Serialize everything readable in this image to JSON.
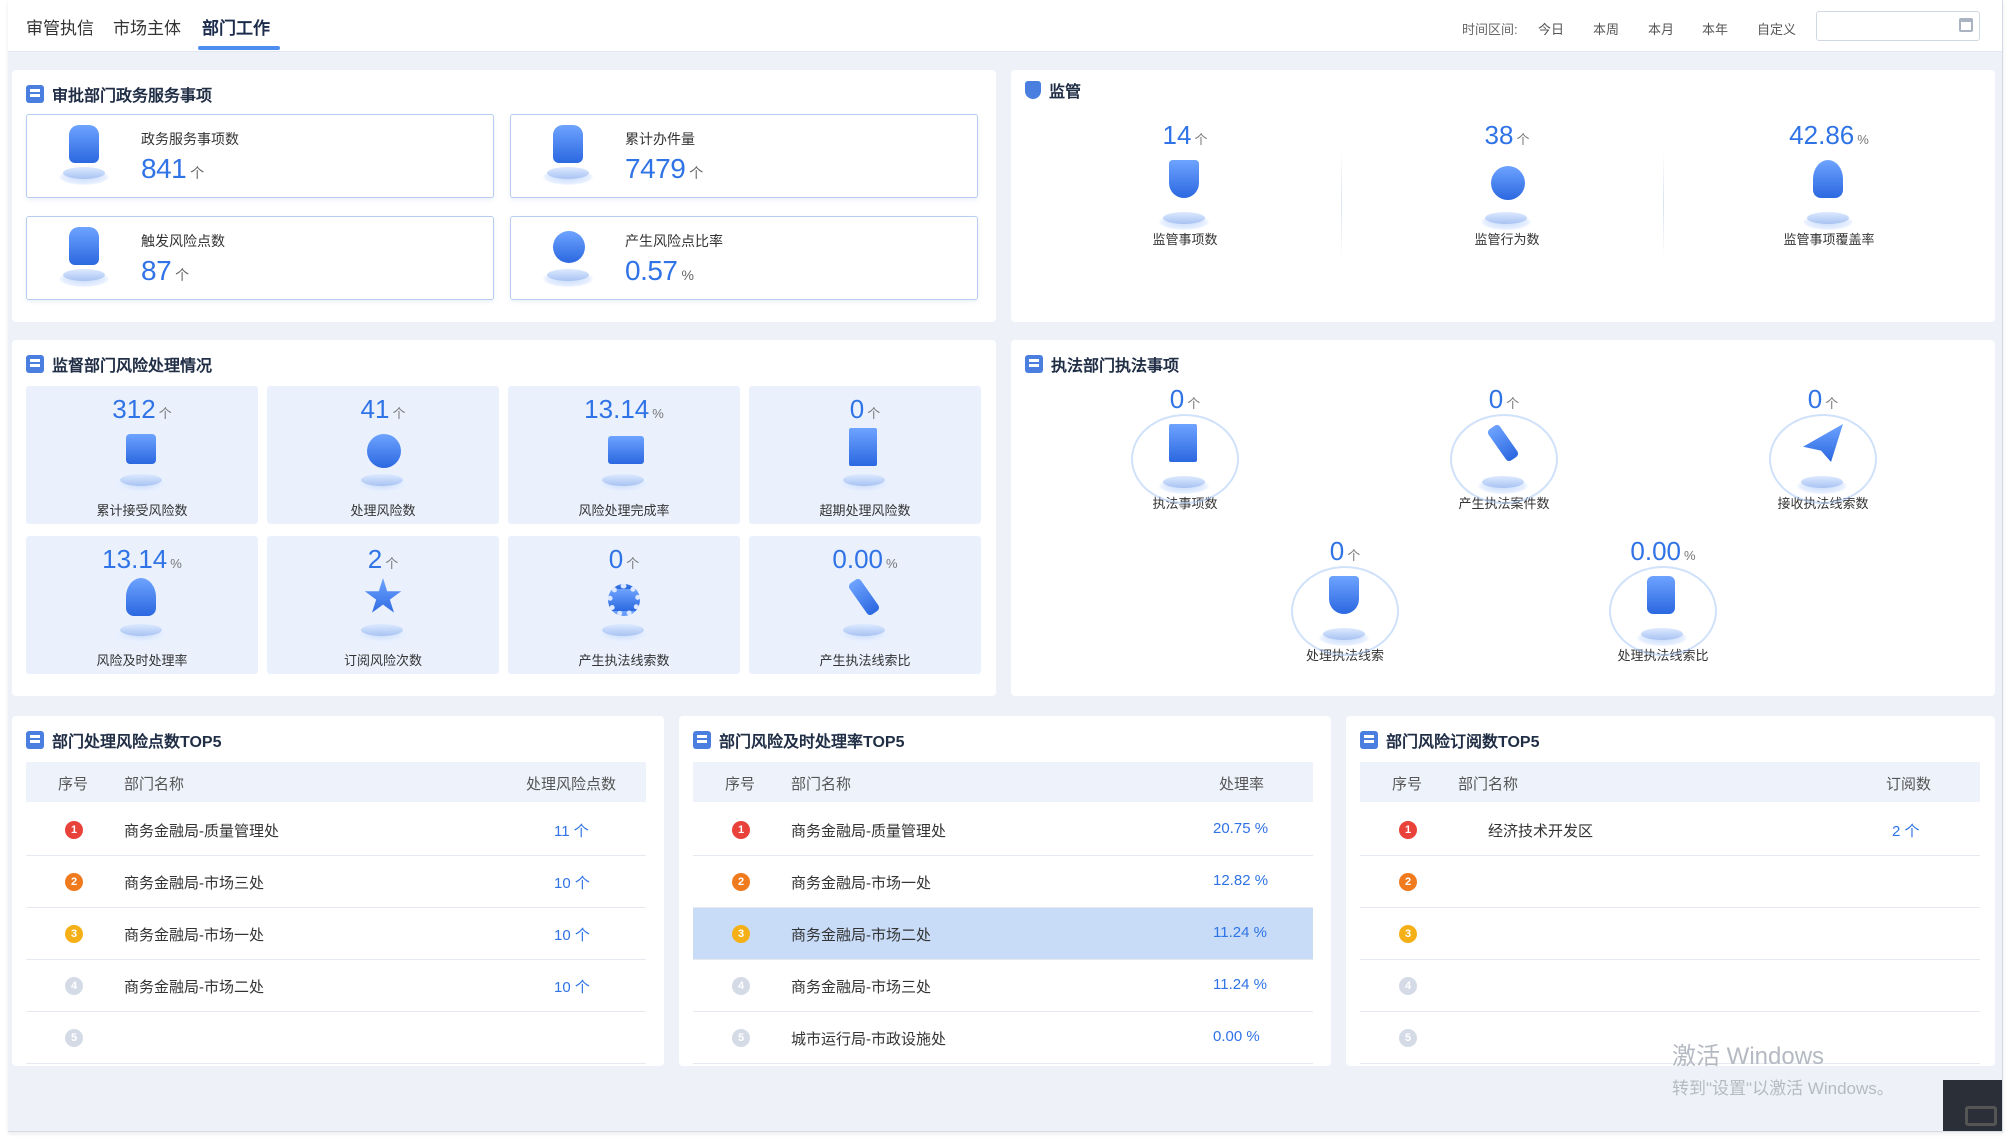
{
  "tabs": [
    {
      "label": "审管执信",
      "active": false
    },
    {
      "label": "市场主体",
      "active": false
    },
    {
      "label": "部门工作",
      "active": true
    }
  ],
  "time_range": {
    "label": "时间区间:",
    "options": [
      "今日",
      "本周",
      "本月",
      "本年",
      "自定义"
    ],
    "input_value": ""
  },
  "approval": {
    "title": "审批部门政务服务事项",
    "cards": [
      {
        "label": "政务服务事项数",
        "value": "841",
        "unit": "个",
        "icon": "building-icon"
      },
      {
        "label": "累计办件量",
        "value": "7479",
        "unit": "个",
        "icon": "building-icon"
      },
      {
        "label": "触发风险点数",
        "value": "87",
        "unit": "个",
        "icon": "building-icon"
      },
      {
        "label": "产生风险点比率",
        "value": "0.57",
        "unit": "%",
        "icon": "check-badge-icon"
      }
    ]
  },
  "supervision": {
    "title": "监管",
    "metrics": [
      {
        "value": "14",
        "unit": "个",
        "label": "监管事项数",
        "icon": "shield-icon"
      },
      {
        "value": "38",
        "unit": "个",
        "label": "监管行为数",
        "icon": "globe-icon"
      },
      {
        "value": "42.86",
        "unit": "%",
        "label": "监管事项覆盖率",
        "icon": "person-icon"
      }
    ]
  },
  "risk": {
    "title": "监督部门风险处理情况",
    "tiles": [
      {
        "value": "312",
        "unit": "个",
        "label": "累计接受风险数",
        "icon": "layers-icon"
      },
      {
        "value": "41",
        "unit": "个",
        "label": "处理风险数",
        "icon": "check-circle-icon"
      },
      {
        "value": "13.14",
        "unit": "%",
        "label": "风险处理完成率",
        "icon": "monitor-icon"
      },
      {
        "value": "0",
        "unit": "个",
        "label": "超期处理风险数",
        "icon": "hourglass-icon"
      },
      {
        "value": "13.14",
        "unit": "%",
        "label": "风险及时处理率",
        "icon": "person-icon"
      },
      {
        "value": "2",
        "unit": "个",
        "label": "订阅风险次数",
        "icon": "star-icon"
      },
      {
        "value": "0",
        "unit": "个",
        "label": "产生执法线索数",
        "icon": "gears-icon"
      },
      {
        "value": "0.00",
        "unit": "%",
        "label": "产生执法线索比",
        "icon": "gavel-icon"
      }
    ]
  },
  "enforcement": {
    "title": "执法部门执法事项",
    "metrics": [
      {
        "value": "0",
        "unit": "个",
        "label": "执法事项数",
        "icon": "hourglass-icon"
      },
      {
        "value": "0",
        "unit": "个",
        "label": "产生执法案件数",
        "icon": "gavel-icon"
      },
      {
        "value": "0",
        "unit": "个",
        "label": "接收执法线索数",
        "icon": "paper-plane-icon"
      },
      {
        "value": "0",
        "unit": "个",
        "label": "处理执法线索",
        "icon": "shield-icon"
      },
      {
        "value": "0.00",
        "unit": "%",
        "label": "处理执法线索比",
        "icon": "document-icon"
      }
    ]
  },
  "top_risk_points": {
    "title": "部门处理风险点数TOP5",
    "headers": [
      "序号",
      "部门名称",
      "处理风险点数"
    ],
    "rows": [
      {
        "rank": "1",
        "name": "商务金融局-质量管理处",
        "value": "11 个"
      },
      {
        "rank": "2",
        "name": "商务金融局-市场三处",
        "value": "10 个"
      },
      {
        "rank": "3",
        "name": "商务金融局-市场一处",
        "value": "10 个"
      },
      {
        "rank": "4",
        "name": "商务金融局-市场二处",
        "value": "10 个"
      },
      {
        "rank": "5",
        "name": "",
        "value": ""
      }
    ]
  },
  "top_timely_rate": {
    "title": "部门风险及时处理率TOP5",
    "headers": [
      "序号",
      "部门名称",
      "处理率"
    ],
    "rows": [
      {
        "rank": "1",
        "name": "商务金融局-质量管理处",
        "value": "20.75 %"
      },
      {
        "rank": "2",
        "name": "商务金融局-市场一处",
        "value": "12.82 %"
      },
      {
        "rank": "3",
        "name": "商务金融局-市场二处",
        "value": "11.24 %"
      },
      {
        "rank": "4",
        "name": "商务金融局-市场三处",
        "value": "11.24 %"
      },
      {
        "rank": "5",
        "name": "城市运行局-市政设施处",
        "value": "0.00 %"
      }
    ]
  },
  "top_subscriptions": {
    "title": "部门风险订阅数TOP5",
    "headers": [
      "序号",
      "部门名称",
      "订阅数"
    ],
    "rows": [
      {
        "rank": "1",
        "name": "经济技术开发区",
        "value": "2 个"
      },
      {
        "rank": "2",
        "name": "",
        "value": ""
      },
      {
        "rank": "3",
        "name": "",
        "value": ""
      },
      {
        "rank": "4",
        "name": "",
        "value": ""
      },
      {
        "rank": "5",
        "name": "",
        "value": ""
      }
    ]
  },
  "watermark": {
    "line1": "激活 Windows",
    "line2": "转到\"设置\"以激活 Windows。"
  },
  "colors": {
    "accent": "#2f73e6",
    "rank1": "#e8423a",
    "rank2": "#f07a1e",
    "rank3": "#f5b018",
    "rank_rest": "#d4dbe6",
    "highlight_row": "#c8dcf8"
  }
}
